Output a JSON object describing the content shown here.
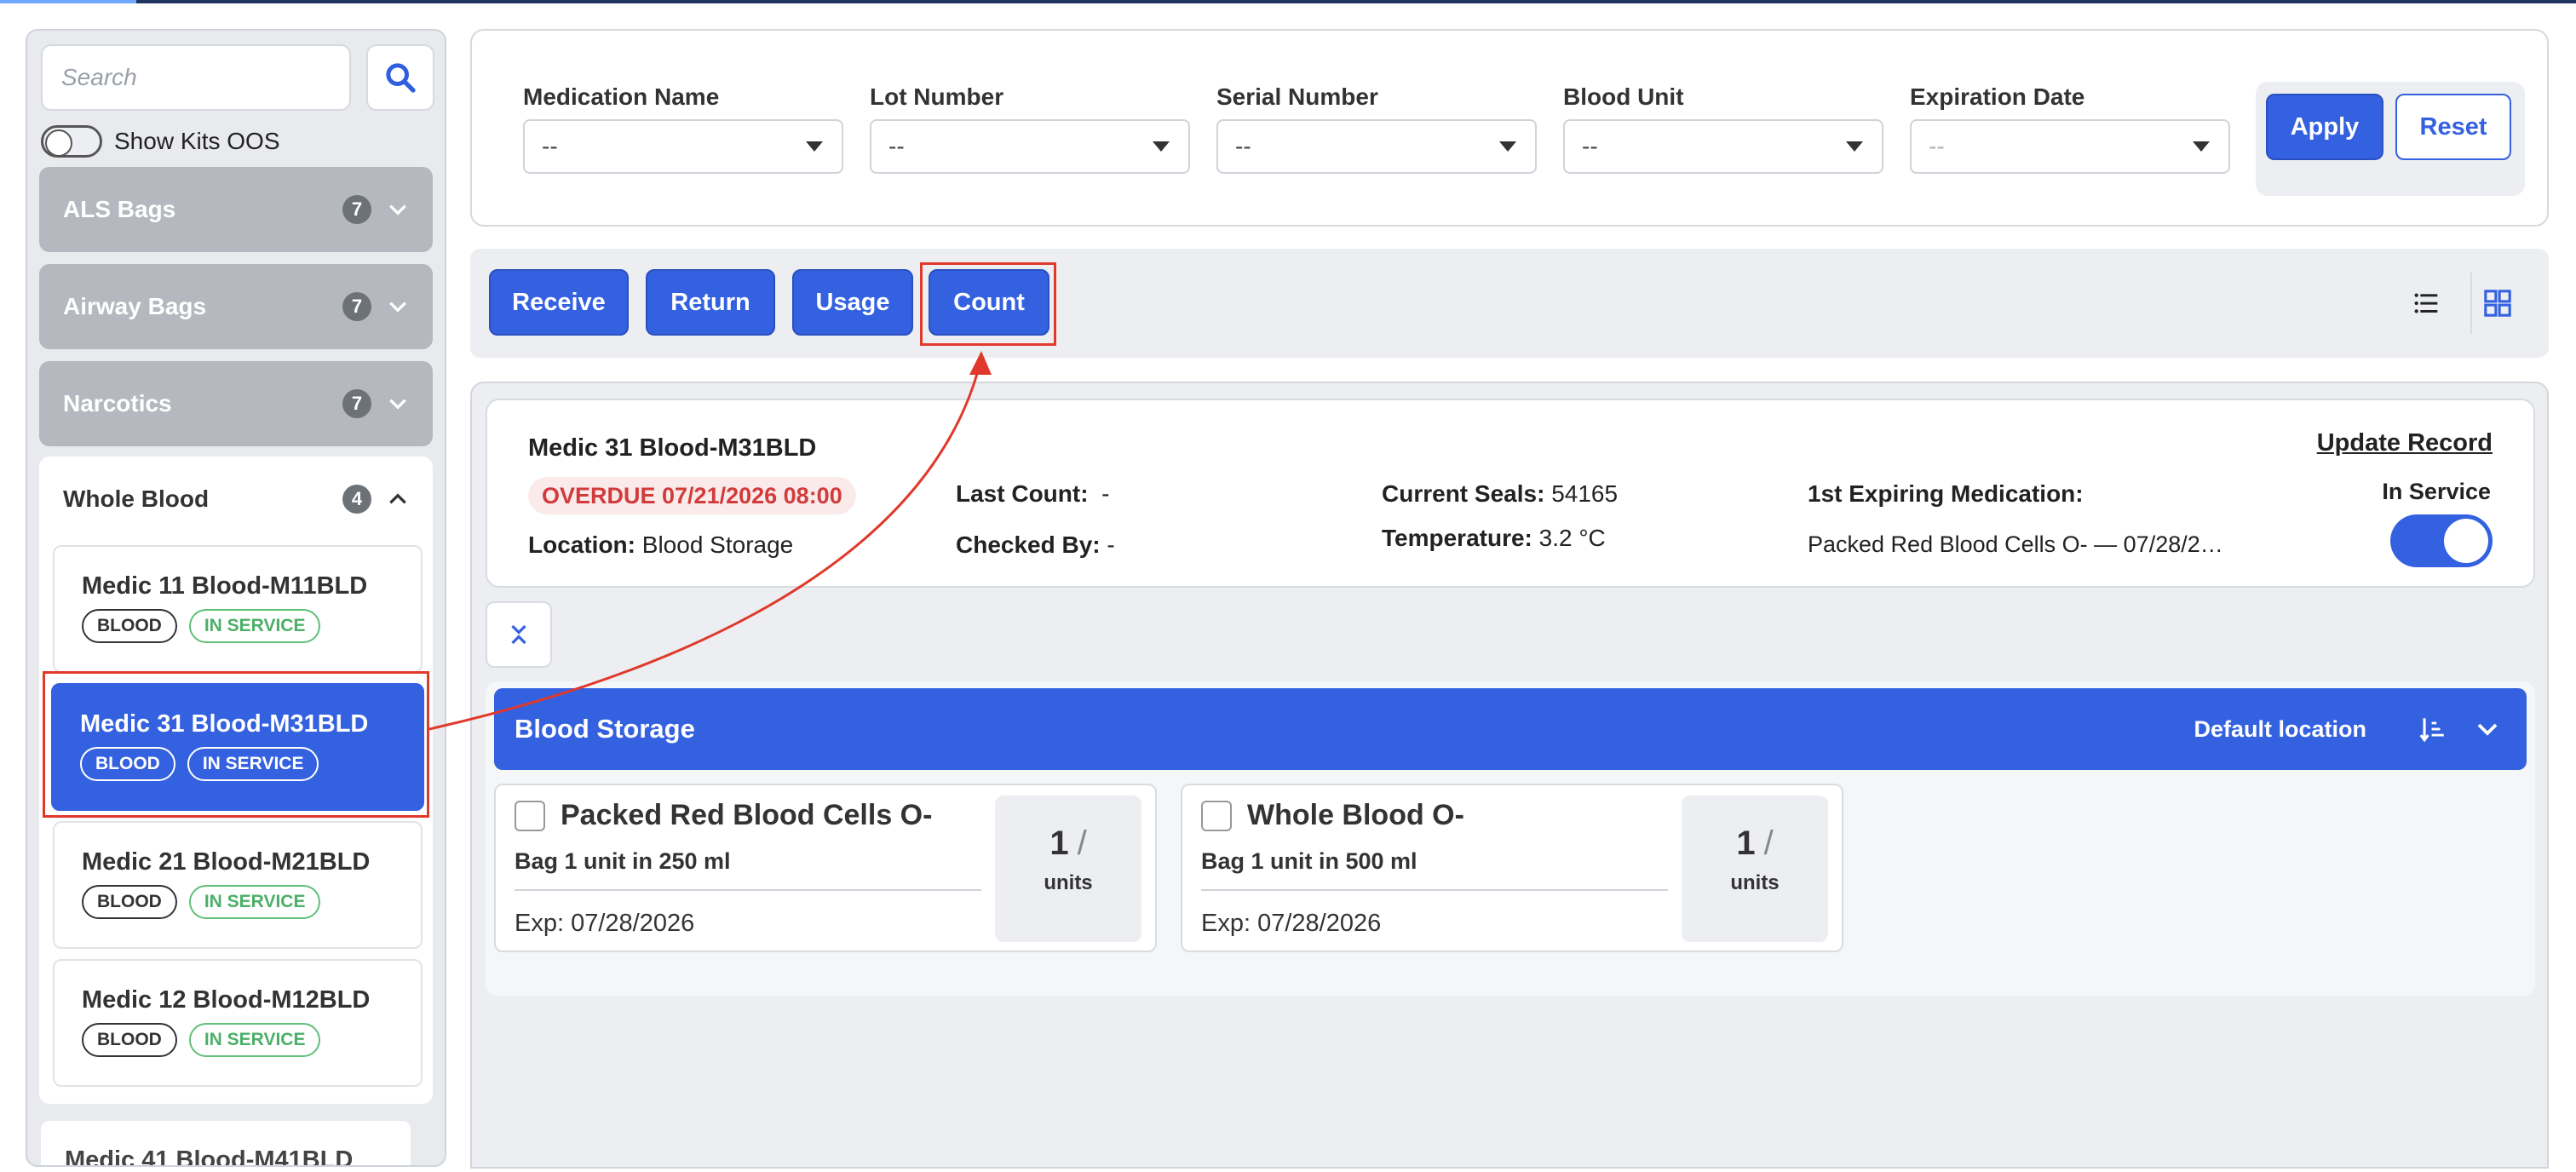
{
  "sidebar": {
    "search_placeholder": "Search",
    "show_kits_oos_label": "Show Kits OOS",
    "groups": [
      {
        "label": "ALS Bags",
        "count": "7"
      },
      {
        "label": "Airway Bags",
        "count": "7"
      },
      {
        "label": "Narcotics",
        "count": "7"
      }
    ],
    "whole_blood": {
      "label": "Whole Blood",
      "count": "4",
      "units": [
        {
          "name": "Medic 11 Blood-M11BLD",
          "tag1": "BLOOD",
          "tag2": "IN SERVICE"
        },
        {
          "name": "Medic 31 Blood-M31BLD",
          "tag1": "BLOOD",
          "tag2": "IN SERVICE"
        },
        {
          "name": "Medic 21 Blood-M21BLD",
          "tag1": "BLOOD",
          "tag2": "IN SERVICE"
        },
        {
          "name": "Medic 12 Blood-M12BLD",
          "tag1": "BLOOD",
          "tag2": "IN SERVICE"
        }
      ],
      "partial_unit": "Medic 41 Blood-M41BLD"
    }
  },
  "filters": {
    "fields": [
      {
        "label": "Medication Name",
        "value": "--"
      },
      {
        "label": "Lot Number",
        "value": "--"
      },
      {
        "label": "Serial Number",
        "value": "--"
      },
      {
        "label": "Blood Unit",
        "value": "--"
      },
      {
        "label": "Expiration Date",
        "value": "--"
      }
    ],
    "apply_label": "Apply",
    "reset_label": "Reset"
  },
  "actions": {
    "receive": "Receive",
    "return": "Return",
    "usage": "Usage",
    "count": "Count"
  },
  "record": {
    "title": "Medic 31 Blood-M31BLD",
    "overdue": "OVERDUE 07/21/2026 08:00",
    "location_label": "Location:",
    "location_value": "Blood Storage",
    "last_count_label": "Last Count:",
    "last_count_value": "-",
    "checked_by_label": "Checked By:",
    "checked_by_value": "-",
    "seals_label": "Current Seals:",
    "seals_value": "54165",
    "temp_label": "Temperature:",
    "temp_value": "3.2 °C",
    "expiring_label": "1st Expiring Medication:",
    "expiring_value": "Packed Red Blood Cells O- — 07/28/2…",
    "update_link": "Update Record",
    "in_service_label": "In Service",
    "in_service": true
  },
  "location": {
    "title": "Blood Storage",
    "default_label": "Default location",
    "items": [
      {
        "name": "Packed Red Blood Cells O-",
        "desc": "Bag 1 unit in 250 ml",
        "exp": "Exp: 07/28/2026",
        "qty": "1",
        "slash": "/",
        "unit": "units"
      },
      {
        "name": "Whole Blood O-",
        "desc": "Bag 1 unit in 500 ml",
        "exp": "Exp: 07/28/2026",
        "qty": "1",
        "slash": "/",
        "unit": "units"
      }
    ]
  },
  "colors": {
    "primary": "#3461e0",
    "annotation": "#e0392b",
    "overdue": "#d23b3b",
    "in_service_green": "#4caf67"
  }
}
